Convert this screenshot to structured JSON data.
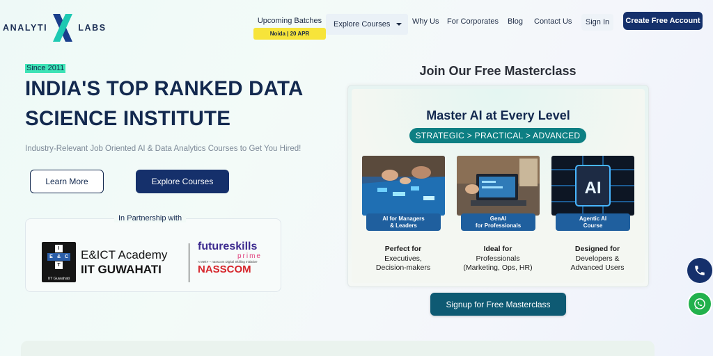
{
  "header": {
    "logo_left": "ANALYTI",
    "logo_right": "LABS",
    "upcoming_label": "Upcoming Batches",
    "upcoming_badge": "Noida | 20 APR",
    "explore_dropdown": "Explore Courses",
    "nav": [
      "Why Us",
      "For Corporates",
      "Blog",
      "Contact Us"
    ],
    "signin": "Sign In",
    "create_account": "Create Free Account"
  },
  "hero": {
    "since": "Since 2011",
    "headline_line1": "INDIA'S TOP RANKED DATA",
    "headline_line2": "SCIENCE INSTITUTE",
    "subline": "Industry-Relevant Job Oriented AI & Data Analytics Courses to Get You Hired!",
    "learn_more": "Learn More",
    "explore_courses": "Explore Courses"
  },
  "partners": {
    "title": "In Partnership with",
    "eict_line1": "E&ICT Academy",
    "eict_line2": "IIT GUWAHATI",
    "eict_emblem_caption": "IIT Guwahati",
    "futureskills": "futureskills",
    "prime": "prime",
    "fs_tagline": "A MeitY – nasscom Digital Skilling Initiative",
    "nasscom": "NASSCOM"
  },
  "masterclass": {
    "join_title": "Join Our Free Masterclass",
    "heading": "Master AI at Every Level",
    "pill": "STRATEGIC > PRACTICAL > ADVANCED",
    "tiles": [
      {
        "badge_l1": "AI for Managers",
        "badge_l2": "& Leaders",
        "title": "Perfect for",
        "desc_l1": "Executives,",
        "desc_l2": "Decision-makers"
      },
      {
        "badge_l1": "GenAI",
        "badge_l2": "for Professionals",
        "title": "Ideal for",
        "desc_l1": "Professionals",
        "desc_l2": "(Marketing, Ops, HR)"
      },
      {
        "badge_l1": "Agentic AI",
        "badge_l2": "Course",
        "title": "Designed for",
        "desc_l1": "Developers &",
        "desc_l2": "Advanced Users"
      }
    ],
    "signup": "Signup for Free Masterclass"
  },
  "icons": {
    "phone": "phone-icon",
    "whatsapp": "whatsapp-icon",
    "dropdown": "chevron-down-icon"
  },
  "colors": {
    "navy": "#15306b",
    "teal": "#0d7f83",
    "highlight": "#3ee3b6",
    "badge_yellow": "#f7e43a",
    "whatsapp": "#22b14c"
  }
}
